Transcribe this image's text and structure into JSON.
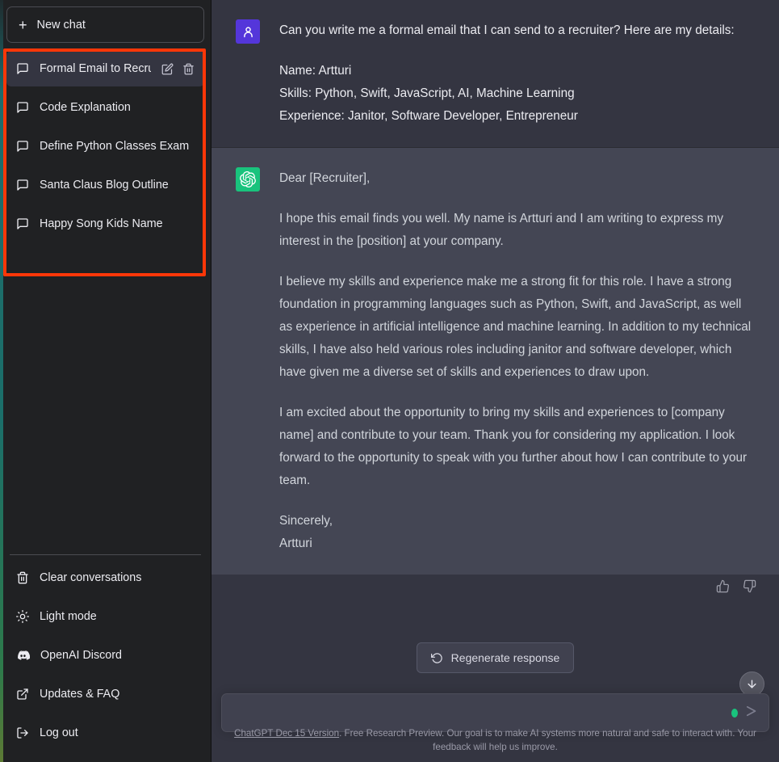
{
  "sidebar": {
    "new_chat_label": "New chat",
    "conversations": [
      {
        "title": "Formal Email to Recrui",
        "active": true
      },
      {
        "title": "Code Explanation",
        "active": false
      },
      {
        "title": "Define Python Classes Exam",
        "active": false
      },
      {
        "title": "Santa Claus Blog Outline",
        "active": false
      },
      {
        "title": "Happy Song Kids Name",
        "active": false
      }
    ],
    "menu": [
      {
        "label": "Clear conversations",
        "icon": "trash-icon"
      },
      {
        "label": "Light mode",
        "icon": "sun-icon"
      },
      {
        "label": "OpenAI Discord",
        "icon": "discord-icon"
      },
      {
        "label": "Updates & FAQ",
        "icon": "external-link-icon"
      },
      {
        "label": "Log out",
        "icon": "logout-icon"
      }
    ]
  },
  "conversation": {
    "user_message": {
      "intro": "Can you write me a formal email that I can send to a recruiter? Here are my details:",
      "details": "Name: Artturi\nSkills: Python, Swift, JavaScript, AI, Machine Learning\nExperience: Janitor, Software Developer, Entrepreneur"
    },
    "assistant_message": {
      "greeting": "Dear [Recruiter],",
      "paragraph_1": "I hope this email finds you well. My name is Artturi and I am writing to express my interest in the [position] at your company.",
      "paragraph_2": "I believe my skills and experience make me a strong fit for this role. I have a strong foundation in programming languages such as Python, Swift, and JavaScript, as well as experience in artificial intelligence and machine learning. In addition to my technical skills, I have also held various roles including janitor and software developer, which have given me a diverse set of skills and experiences to draw upon.",
      "paragraph_3": "I am excited about the opportunity to bring my skills and experiences to [company name] and contribute to your team. Thank you for considering my application. I look forward to the opportunity to speak with you further about how I can contribute to your team.",
      "signoff": "Sincerely,\nArtturi"
    }
  },
  "composer": {
    "regenerate_label": "Regenerate response",
    "input_value": "",
    "input_placeholder": ""
  },
  "footer": {
    "version_link": "ChatGPT Dec 15 Version",
    "disclaimer": ". Free Research Preview. Our goal is to make AI systems more natural and safe to interact with. Your feedback will help us improve."
  },
  "colors": {
    "sidebar_bg": "#202123",
    "user_msg_bg": "#343541",
    "assistant_msg_bg": "#444654",
    "user_avatar": "#5436DA",
    "assistant_avatar": "#19C37D",
    "annotation_red": "#FC3708",
    "accent_strip_teal": "#1B6F6A"
  }
}
